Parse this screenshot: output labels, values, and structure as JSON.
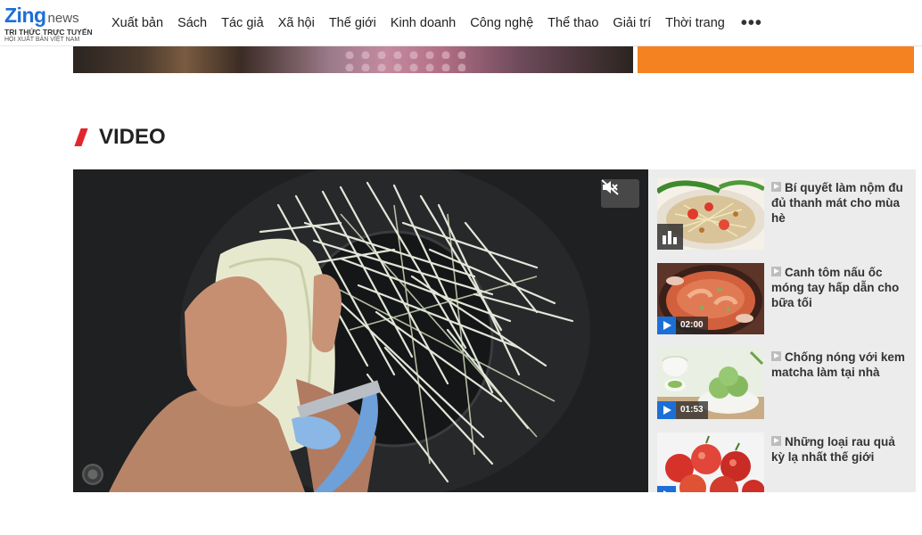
{
  "header": {
    "logo_brand": "Zing",
    "logo_suffix": "news",
    "logo_tagline": "TRI THỨC TRỰC TUYẾN",
    "logo_subtagline": "HỘI XUẤT BẢN VIỆT NAM",
    "nav": [
      "Xuất bản",
      "Sách",
      "Tác giả",
      "Xã hội",
      "Thế giới",
      "Kinh doanh",
      "Công nghệ",
      "Thể thao",
      "Giải trí",
      "Thời trang"
    ],
    "more_label": "•••"
  },
  "section": {
    "title": "VIDEO",
    "accent_color": "#e2262a"
  },
  "player": {
    "mute_icon": "speaker-muted-icon",
    "loading_icon": "spinner-icon"
  },
  "videos": [
    {
      "title": "Bí quyết làm nộm đu đủ thanh mát cho mùa hè",
      "duration": "",
      "state": "playing"
    },
    {
      "title": "Canh tôm nấu ốc móng tay hấp dẫn cho bữa tối",
      "duration": "02:00",
      "state": "idle"
    },
    {
      "title": "Chống nóng với kem matcha làm tại nhà",
      "duration": "01:53",
      "state": "idle"
    },
    {
      "title": "Những loại rau quả kỳ lạ nhất thế giới",
      "duration": "",
      "state": "idle"
    }
  ],
  "colors": {
    "brand_blue": "#1c6fd6",
    "orange": "#f58220",
    "sidebar_bg": "#ececec"
  }
}
